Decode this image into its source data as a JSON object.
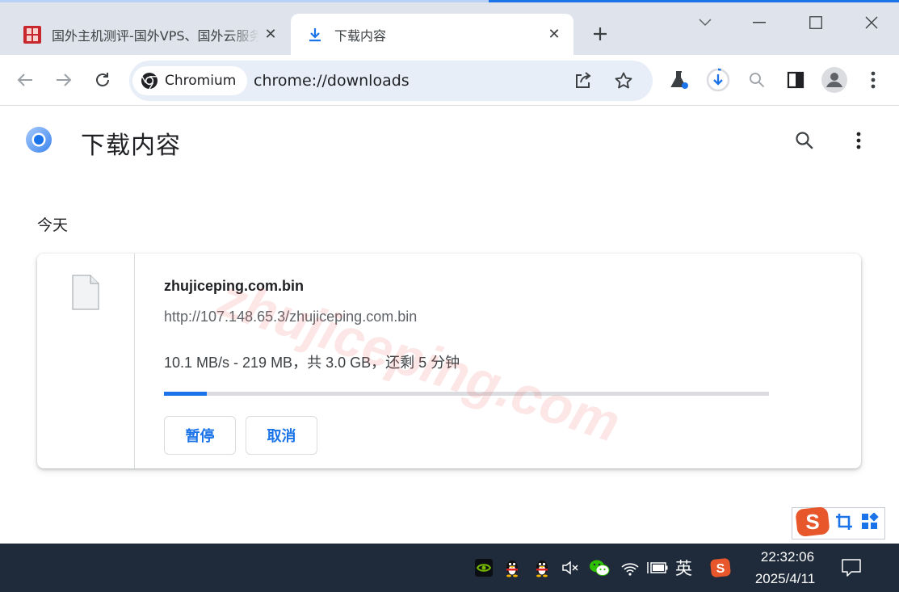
{
  "tabs": [
    {
      "title": "国外主机测评-国外VPS、国外云服务器",
      "close": "✕",
      "favicon": "site-seal-icon",
      "active": false
    },
    {
      "title": "下载内容",
      "close": "✕",
      "favicon": "download-icon",
      "active": true
    }
  ],
  "toolbar": {
    "site_chip_label": "Chromium",
    "url": "chrome://downloads"
  },
  "page": {
    "title": "下载内容",
    "date_heading": "今天"
  },
  "watermark": "zhujiceping.com",
  "download": {
    "file_name": "zhujiceping.com.bin",
    "url": "http://107.148.65.3/zhujiceping.com.bin",
    "status": "10.1 MB/s - 219 MB，共 3.0 GB，还剩 5 分钟",
    "progress_fraction": 0.071,
    "pause_label": "暂停",
    "cancel_label": "取消"
  },
  "taskbar": {
    "ime_lang": "英",
    "time": "22:32:06",
    "date": "2025/4/11"
  },
  "colors": {
    "accent": "#1a73e8",
    "tabstrip": "#dfe3eb",
    "omnibox": "#e8eef7",
    "taskbar": "#1f2b3a",
    "ime_logo": "#e8572c"
  }
}
